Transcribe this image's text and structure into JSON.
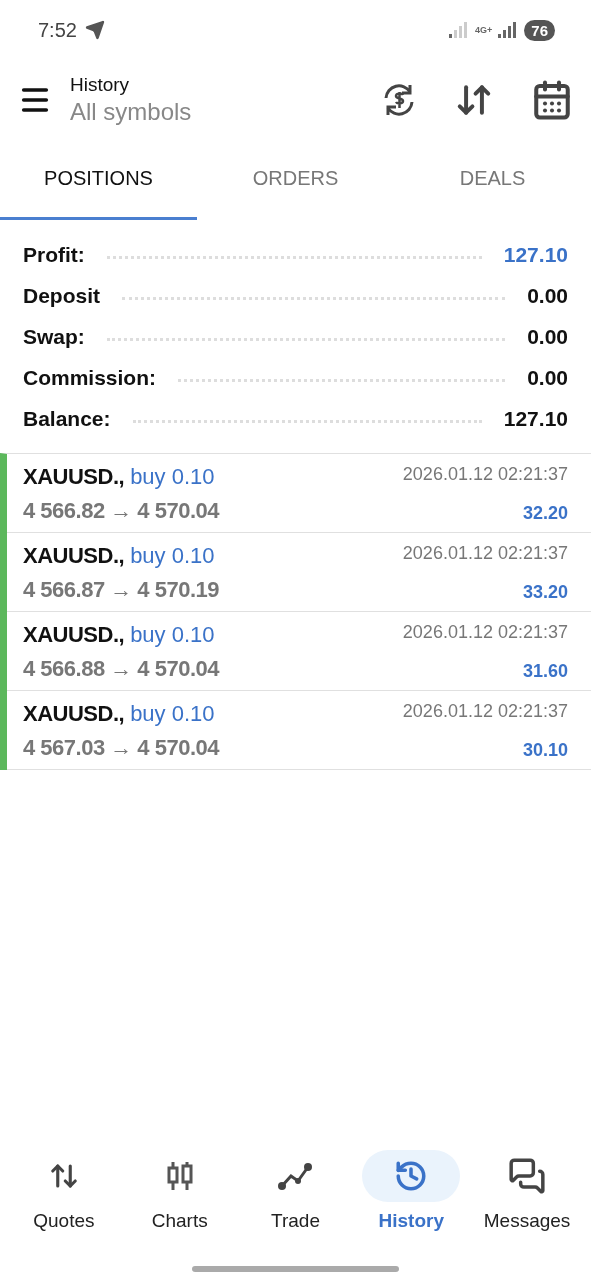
{
  "status_bar": {
    "time": "7:52",
    "network": "4G+",
    "battery": "76"
  },
  "header": {
    "title": "History",
    "subtitle": "All symbols"
  },
  "tabs": [
    {
      "label": "POSITIONS",
      "selected": true
    },
    {
      "label": "ORDERS",
      "selected": false
    },
    {
      "label": "DEALS",
      "selected": false
    }
  ],
  "summary": [
    {
      "label": "Profit:",
      "value": "127.10",
      "accent": true
    },
    {
      "label": "Deposit",
      "value": "0.00",
      "accent": false
    },
    {
      "label": "Swap:",
      "value": "0.00",
      "accent": false
    },
    {
      "label": "Commission:",
      "value": "0.00",
      "accent": false
    },
    {
      "label": "Balance:",
      "value": "127.10",
      "accent": false
    }
  ],
  "positions": [
    {
      "symbol": "XAUUSD.,",
      "side": "buy 0.10",
      "prices": "4 566.82 → 4 570.04",
      "time": "2026.01.12 02:21:37",
      "profit": "32.20"
    },
    {
      "symbol": "XAUUSD.,",
      "side": "buy 0.10",
      "prices": "4 566.87 → 4 570.19",
      "time": "2026.01.12 02:21:37",
      "profit": "33.20"
    },
    {
      "symbol": "XAUUSD.,",
      "side": "buy 0.10",
      "prices": "4 566.88 → 4 570.04",
      "time": "2026.01.12 02:21:37",
      "profit": "31.60"
    },
    {
      "symbol": "XAUUSD.,",
      "side": "buy 0.10",
      "prices": "4 567.03 → 4 570.04",
      "time": "2026.01.12 02:21:37",
      "profit": "30.10"
    }
  ],
  "nav": [
    {
      "kind": "quotes",
      "label": "Quotes",
      "selected": false
    },
    {
      "kind": "charts",
      "label": "Charts",
      "selected": false
    },
    {
      "kind": "trade",
      "label": "Trade",
      "selected": false
    },
    {
      "kind": "history",
      "label": "History",
      "selected": true
    },
    {
      "kind": "messages",
      "label": "Messages",
      "selected": false
    }
  ]
}
